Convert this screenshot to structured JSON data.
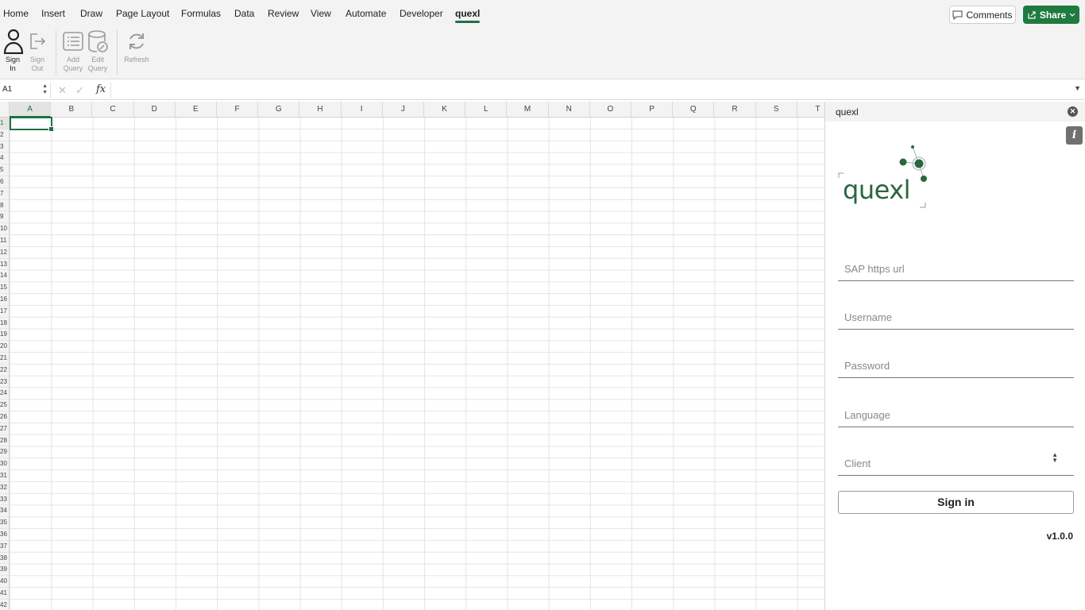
{
  "ribbon_tabs": [
    "Home",
    "Insert",
    "Draw",
    "Page Layout",
    "Formulas",
    "Data",
    "Review",
    "View",
    "Automate",
    "Developer",
    "quexl"
  ],
  "active_tab": "quexl",
  "top_actions": {
    "comments": "Comments",
    "share": "Share"
  },
  "ribbon": {
    "sign_in": "Sign In",
    "sign_out": "Sign Out",
    "add_query": "Add Query",
    "edit_query": "Edit Query",
    "refresh": "Refresh"
  },
  "formula_bar": {
    "name_box": "A1",
    "fx": "fx",
    "formula": ""
  },
  "columns": [
    "A",
    "B",
    "C",
    "D",
    "E",
    "F",
    "G",
    "H",
    "I",
    "J",
    "K",
    "L",
    "M",
    "N",
    "O",
    "P",
    "Q",
    "R",
    "S",
    "T"
  ],
  "selected_column": "A",
  "rows_visible": 42,
  "selected_row": 1,
  "taskpane": {
    "title": "quexl",
    "info_label": "i",
    "logo_text": "quexl",
    "fields": [
      {
        "placeholder": "SAP https url",
        "value": ""
      },
      {
        "placeholder": "Username",
        "value": ""
      },
      {
        "placeholder": "Password",
        "value": ""
      },
      {
        "placeholder": "Language",
        "value": ""
      },
      {
        "placeholder": "Client",
        "value": ""
      }
    ],
    "sign_in_button": "Sign in",
    "version": "v1.0.0"
  },
  "colors": {
    "accent_green": "#1e7145",
    "share_green": "#1f7a3f",
    "logo_green": "#2a6640"
  }
}
